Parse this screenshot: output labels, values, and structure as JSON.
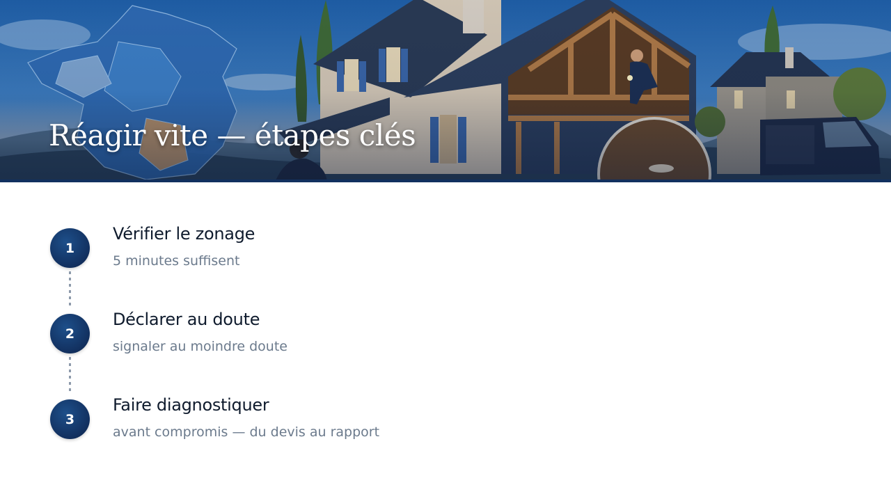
{
  "hero": {
    "title": "Réagir vite — étapes clés"
  },
  "steps": [
    {
      "number": "1",
      "title": "Vérifier le zonage",
      "subtitle": "5 minutes suffisent"
    },
    {
      "number": "2",
      "title": "Déclarer au doute",
      "subtitle": "signaler au moindre doute"
    },
    {
      "number": "3",
      "title": "Faire diagnostiquer",
      "subtitle": "avant compromis — du devis au rapport"
    }
  ],
  "colors": {
    "navy": "#12305f",
    "title_text": "#0f1b2d",
    "subtitle_text": "#6b7a8c",
    "connector": "#8d9aab"
  }
}
